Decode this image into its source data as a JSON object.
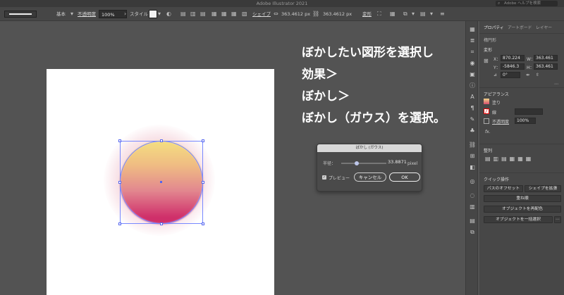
{
  "app": {
    "title": "Adobe Illustrator 2021",
    "help_placeholder": "Adobe ヘルプを検索"
  },
  "control_bar": {
    "stroke_style": "基本",
    "opacity_label": "不透明度",
    "opacity_value": "100%",
    "style_label": "スタイル",
    "shape_label": "シェイプ",
    "width": "363.4612 px",
    "height": "363.4612 px",
    "transform_label": "変形"
  },
  "instructions": {
    "line1": "ぼかしたい図形を選択し",
    "line2": "効果＞",
    "line3": "ぼかし＞",
    "line4": "ぼかし（ガウス）を選択。"
  },
  "dialog": {
    "title": "ぼかし (ガウス)",
    "radius_label": "半径：",
    "radius_value": "33.8871",
    "radius_unit": "pixel",
    "radius_fraction": 0.35,
    "preview_label": "プレビュー",
    "preview_checked": true,
    "cancel_label": "キャンセル",
    "ok_label": "OK"
  },
  "panel": {
    "tabs": [
      "プロパティ",
      "アートボード",
      "レイヤー"
    ],
    "object_type": "楕円形",
    "transform_title": "変形",
    "x_label": "X：",
    "x_value": "870.224",
    "y_label": "Y：",
    "y_value": "-5846.3",
    "w_label": "W：",
    "w_value": "363.461",
    "h_label": "H：",
    "h_value": "363.461",
    "rotation_value": "0°",
    "appearance_title": "アピアランス",
    "fill_label": "塗り",
    "stroke_label": "線",
    "opacity_label": "不透明度",
    "opacity_value": "100%",
    "fx_label": "fx.",
    "align_title": "整列",
    "quick_actions_title": "クイック操作",
    "offset_path": "パスのオフセット",
    "expand_shape": "シェイプを拡張",
    "arrange": "重ね順",
    "recolor": "オブジェクトを再配色",
    "select_same": "オブジェクトを一括選択"
  },
  "colors": {
    "bg": "#535353",
    "panel": "#474747",
    "selection": "#7788ff"
  }
}
